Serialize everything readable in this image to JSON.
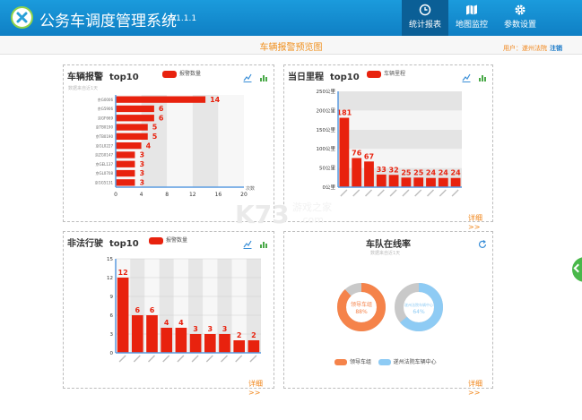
{
  "app": {
    "title": "公务车调度管理系统",
    "version": "V1.1.1"
  },
  "nav": [
    {
      "label": "统计报表",
      "icon": "clock-icon",
      "active": true
    },
    {
      "label": "地图监控",
      "icon": "map-icon",
      "active": false
    },
    {
      "label": "参数设置",
      "icon": "gear-icon",
      "active": false
    }
  ],
  "page": {
    "title": "车辆报警预览图"
  },
  "user": {
    "label": "用户：",
    "name": "遂州法院",
    "logout": "注销"
  },
  "panels": {
    "alarm": {
      "title": "车辆报警",
      "top": "top10",
      "legend": "报警数量",
      "note": "数据来自近1天",
      "axis_unit": "次数"
    },
    "mileage": {
      "title": "当日里程",
      "top": "top10",
      "legend": "车辆里程",
      "detail": "详细>>"
    },
    "illegal": {
      "title": "非法行驶",
      "top": "top10",
      "legend": "报警数量",
      "detail": "详细>>"
    },
    "online": {
      "title": "车队在线率",
      "note": "数据来自近1天",
      "detail": "详细>>"
    }
  },
  "chart_data": [
    {
      "type": "bar",
      "orientation": "horizontal",
      "title": "车辆报警 top10",
      "series": [
        {
          "name": "报警数量",
          "values": [
            14,
            6,
            6,
            5,
            5,
            4,
            3,
            3,
            3,
            3
          ]
        }
      ],
      "categories": [
        "京G0006",
        "京G5906",
        "京GF669",
        "京TB0190",
        "京TB0190",
        "京GL0227",
        "京ZG0147",
        "京GEL137",
        "京GL0708",
        "京GG5131"
      ],
      "xlim": [
        0,
        20
      ],
      "xticks": [
        0,
        4,
        8,
        12,
        16,
        20
      ],
      "xlabel": "次数",
      "grid": true,
      "color": "#e8220e"
    },
    {
      "type": "bar",
      "title": "当日里程 top10",
      "series": [
        {
          "name": "车辆里程",
          "values": [
            181,
            76,
            67,
            33,
            32,
            25,
            25,
            24,
            24,
            24
          ]
        }
      ],
      "ylim": [
        0,
        250
      ],
      "yticks": [
        0,
        50,
        100,
        150,
        200,
        250
      ],
      "ytick_labels": [
        "0公里",
        "50公里",
        "100公里",
        "150公里",
        "200公里",
        "250公里"
      ],
      "grid": true,
      "color": "#e8220e"
    },
    {
      "type": "bar",
      "title": "非法行驶 top10",
      "series": [
        {
          "name": "报警数量",
          "values": [
            12,
            6,
            6,
            4,
            4,
            3,
            3,
            3,
            2,
            2
          ]
        }
      ],
      "ylim": [
        0,
        15
      ],
      "yticks": [
        0,
        3,
        6,
        9,
        12,
        15
      ],
      "grid": true,
      "color": "#e8220e"
    },
    {
      "type": "pie",
      "title": "车队在线率",
      "donuts": [
        {
          "name": "领导车组",
          "center_label": "领导车组",
          "percent_label": "88%",
          "value": 88,
          "color": "#f5834a",
          "rest_color": "#c9c9c9"
        },
        {
          "name": "遂州法院车辆中心",
          "center_label": "遂州法院车辆中心",
          "percent_label": "64%",
          "value": 64,
          "color": "#8ecbf4",
          "rest_color": "#c9c9c9"
        }
      ]
    }
  ]
}
